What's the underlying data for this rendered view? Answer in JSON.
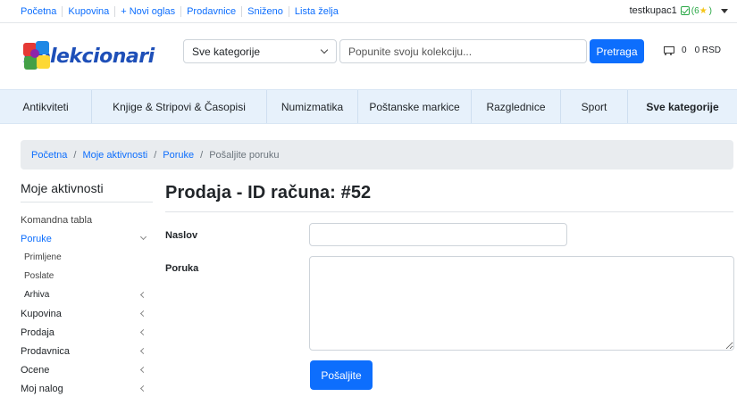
{
  "top_links": [
    "Početna",
    "Kupovina",
    "+ Novi oglas",
    "Prodavnice",
    "Sniženo",
    "Lista želja"
  ],
  "user": {
    "name": "testkupac1",
    "rating": "(6",
    "rating_close": ")"
  },
  "logo_text": "Kolekcionari",
  "search": {
    "category": "Sve kategorije",
    "placeholder": "Popunite svoju kolekciju...",
    "button": "Pretraga"
  },
  "cart": {
    "count": "0",
    "total": "0 RSD"
  },
  "categories": [
    "Antikviteti",
    "Knjige & Stripovi & Časopisi",
    "Numizmatika",
    "Poštanske markice",
    "Razglednice",
    "Sport",
    "Sve kategorije"
  ],
  "breadcrumb": {
    "items": [
      "Početna",
      "Moje aktivnosti",
      "Poruke"
    ],
    "current": "Pošaljite poruku"
  },
  "sidebar": {
    "title": "Moje aktivnosti",
    "dashboard": "Komandna tabla",
    "messages": "Poruke",
    "received": "Primljene",
    "sent": "Poslate",
    "archive": "Arhiva",
    "items": [
      "Kupovina",
      "Prodaja",
      "Prodavnica",
      "Ocene",
      "Moj nalog"
    ]
  },
  "main": {
    "title": "Prodaja - ID računa: #52",
    "subject_label": "Naslov",
    "message_label": "Poruka",
    "subject_value": "",
    "message_value": "",
    "send_button": "Pošaljite"
  }
}
